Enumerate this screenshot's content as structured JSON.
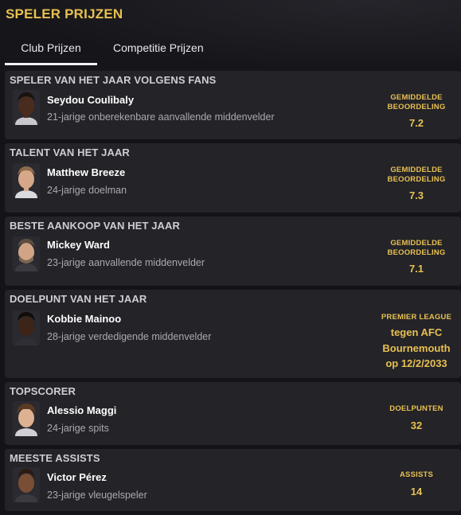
{
  "page": {
    "title": "SPELER PRIJZEN"
  },
  "tabs": [
    {
      "label": "Club Prijzen",
      "active": true
    },
    {
      "label": "Competitie Prijzen",
      "active": false
    }
  ],
  "colors": {
    "accent": "#e8c051",
    "card": "#232328",
    "background": "#141418"
  },
  "awards": [
    {
      "title": "SPELER VAN HET JAAR VOLGENS FANS",
      "player": "Seydou Coulibaly",
      "description": "21-jarige onberekenbare aanvallende middenvelder",
      "stat_label_1": "GEMIDDELDE",
      "stat_label_2": "BEOORDELING",
      "stat_value": "7.2"
    },
    {
      "title": "TALENT VAN HET JAAR",
      "player": "Matthew Breeze",
      "description": "24-jarige doelman",
      "stat_label_1": "GEMIDDELDE",
      "stat_label_2": "BEOORDELING",
      "stat_value": "7.3"
    },
    {
      "title": "BESTE AANKOOP VAN HET JAAR",
      "player": "Mickey Ward",
      "description": "23-jarige aanvallende middenvelder",
      "stat_label_1": "GEMIDDELDE",
      "stat_label_2": "BEOORDELING",
      "stat_value": "7.1"
    },
    {
      "title": "DOELPUNT VAN HET JAAR",
      "player": "Kobbie Mainoo",
      "description": "28-jarige verdedigende middenvelder",
      "stat_label_1": "PREMIER LEAGUE",
      "goal_line_1": "tegen AFC",
      "goal_line_2": "Bournemouth",
      "goal_line_3": "op 12/2/2033"
    },
    {
      "title": "TOPSCORER",
      "player": "Alessio Maggi",
      "description": "24-jarige spits",
      "stat_label_1": "DOELPUNTEN",
      "stat_value": "32"
    },
    {
      "title": "MEESTE ASSISTS",
      "player": "Victor Pérez",
      "description": "23-jarige vleugelspeler",
      "stat_label_1": "ASSISTS",
      "stat_value": "14"
    }
  ]
}
